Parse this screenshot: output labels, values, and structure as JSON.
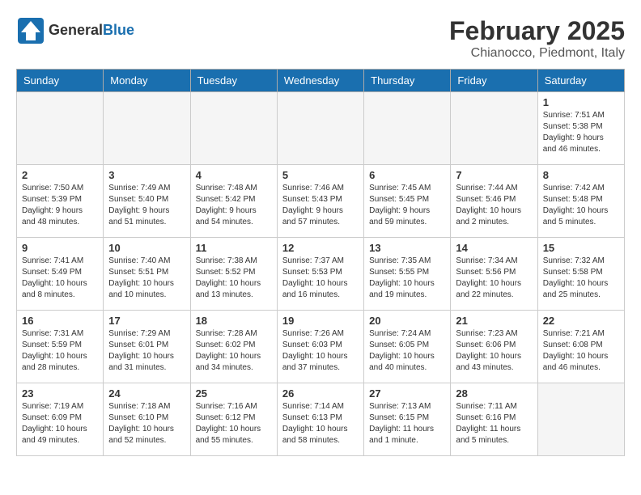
{
  "header": {
    "logo_general": "General",
    "logo_blue": "Blue",
    "month_title": "February 2025",
    "location": "Chianocco, Piedmont, Italy"
  },
  "days_of_week": [
    "Sunday",
    "Monday",
    "Tuesday",
    "Wednesday",
    "Thursday",
    "Friday",
    "Saturday"
  ],
  "weeks": [
    [
      {
        "day": "",
        "info": ""
      },
      {
        "day": "",
        "info": ""
      },
      {
        "day": "",
        "info": ""
      },
      {
        "day": "",
        "info": ""
      },
      {
        "day": "",
        "info": ""
      },
      {
        "day": "",
        "info": ""
      },
      {
        "day": "1",
        "info": "Sunrise: 7:51 AM\nSunset: 5:38 PM\nDaylight: 9 hours and 46 minutes."
      }
    ],
    [
      {
        "day": "2",
        "info": "Sunrise: 7:50 AM\nSunset: 5:39 PM\nDaylight: 9 hours and 48 minutes."
      },
      {
        "day": "3",
        "info": "Sunrise: 7:49 AM\nSunset: 5:40 PM\nDaylight: 9 hours and 51 minutes."
      },
      {
        "day": "4",
        "info": "Sunrise: 7:48 AM\nSunset: 5:42 PM\nDaylight: 9 hours and 54 minutes."
      },
      {
        "day": "5",
        "info": "Sunrise: 7:46 AM\nSunset: 5:43 PM\nDaylight: 9 hours and 57 minutes."
      },
      {
        "day": "6",
        "info": "Sunrise: 7:45 AM\nSunset: 5:45 PM\nDaylight: 9 hours and 59 minutes."
      },
      {
        "day": "7",
        "info": "Sunrise: 7:44 AM\nSunset: 5:46 PM\nDaylight: 10 hours and 2 minutes."
      },
      {
        "day": "8",
        "info": "Sunrise: 7:42 AM\nSunset: 5:48 PM\nDaylight: 10 hours and 5 minutes."
      }
    ],
    [
      {
        "day": "9",
        "info": "Sunrise: 7:41 AM\nSunset: 5:49 PM\nDaylight: 10 hours and 8 minutes."
      },
      {
        "day": "10",
        "info": "Sunrise: 7:40 AM\nSunset: 5:51 PM\nDaylight: 10 hours and 10 minutes."
      },
      {
        "day": "11",
        "info": "Sunrise: 7:38 AM\nSunset: 5:52 PM\nDaylight: 10 hours and 13 minutes."
      },
      {
        "day": "12",
        "info": "Sunrise: 7:37 AM\nSunset: 5:53 PM\nDaylight: 10 hours and 16 minutes."
      },
      {
        "day": "13",
        "info": "Sunrise: 7:35 AM\nSunset: 5:55 PM\nDaylight: 10 hours and 19 minutes."
      },
      {
        "day": "14",
        "info": "Sunrise: 7:34 AM\nSunset: 5:56 PM\nDaylight: 10 hours and 22 minutes."
      },
      {
        "day": "15",
        "info": "Sunrise: 7:32 AM\nSunset: 5:58 PM\nDaylight: 10 hours and 25 minutes."
      }
    ],
    [
      {
        "day": "16",
        "info": "Sunrise: 7:31 AM\nSunset: 5:59 PM\nDaylight: 10 hours and 28 minutes."
      },
      {
        "day": "17",
        "info": "Sunrise: 7:29 AM\nSunset: 6:01 PM\nDaylight: 10 hours and 31 minutes."
      },
      {
        "day": "18",
        "info": "Sunrise: 7:28 AM\nSunset: 6:02 PM\nDaylight: 10 hours and 34 minutes."
      },
      {
        "day": "19",
        "info": "Sunrise: 7:26 AM\nSunset: 6:03 PM\nDaylight: 10 hours and 37 minutes."
      },
      {
        "day": "20",
        "info": "Sunrise: 7:24 AM\nSunset: 6:05 PM\nDaylight: 10 hours and 40 minutes."
      },
      {
        "day": "21",
        "info": "Sunrise: 7:23 AM\nSunset: 6:06 PM\nDaylight: 10 hours and 43 minutes."
      },
      {
        "day": "22",
        "info": "Sunrise: 7:21 AM\nSunset: 6:08 PM\nDaylight: 10 hours and 46 minutes."
      }
    ],
    [
      {
        "day": "23",
        "info": "Sunrise: 7:19 AM\nSunset: 6:09 PM\nDaylight: 10 hours and 49 minutes."
      },
      {
        "day": "24",
        "info": "Sunrise: 7:18 AM\nSunset: 6:10 PM\nDaylight: 10 hours and 52 minutes."
      },
      {
        "day": "25",
        "info": "Sunrise: 7:16 AM\nSunset: 6:12 PM\nDaylight: 10 hours and 55 minutes."
      },
      {
        "day": "26",
        "info": "Sunrise: 7:14 AM\nSunset: 6:13 PM\nDaylight: 10 hours and 58 minutes."
      },
      {
        "day": "27",
        "info": "Sunrise: 7:13 AM\nSunset: 6:15 PM\nDaylight: 11 hours and 1 minute."
      },
      {
        "day": "28",
        "info": "Sunrise: 7:11 AM\nSunset: 6:16 PM\nDaylight: 11 hours and 5 minutes."
      },
      {
        "day": "",
        "info": ""
      }
    ]
  ]
}
